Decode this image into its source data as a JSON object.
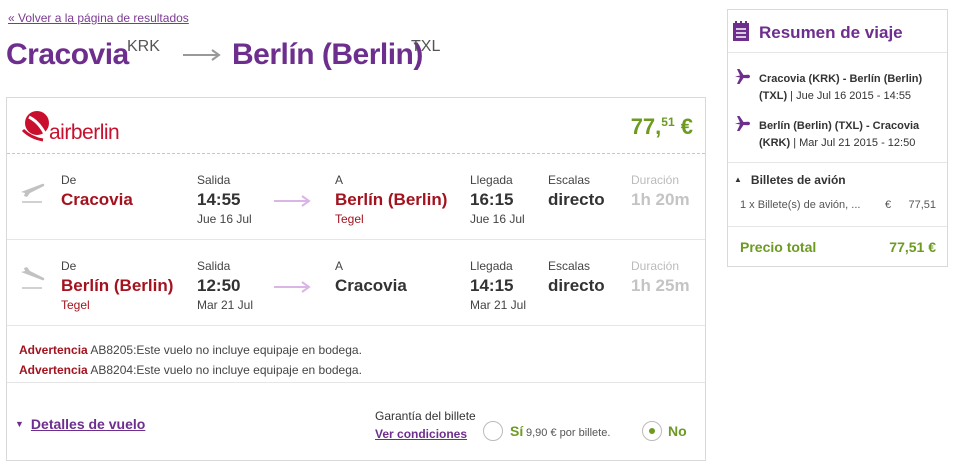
{
  "back_link": "« Volver a la página de resultados",
  "route": {
    "origin_city": "Cracovia",
    "origin_code": "KRK",
    "destination_city": "Berlín (Berlin)",
    "destination_code": "TXL"
  },
  "card": {
    "airline_logo_text": "airberlin",
    "price_int": "77,",
    "price_dec": "51",
    "price_currency": " €",
    "legs": [
      {
        "from_label": "De",
        "from_city": "Cracovia",
        "from_airport": "",
        "depart_label": "Salida",
        "depart_time": "14:55",
        "depart_date": "Jue 16 Jul",
        "to_label": "A",
        "to_city": "Berlín (Berlin)",
        "to_airport": "Tegel",
        "arrive_label": "Llegada",
        "arrive_time": "16:15",
        "arrive_date": "Jue 16 Jul",
        "stops_label": "Escalas",
        "stops_value": "directo",
        "duration_label": "Duración",
        "duration_value": "1h 20m"
      },
      {
        "from_label": "De",
        "from_city": "Berlín (Berlin)",
        "from_airport": "Tegel",
        "depart_label": "Salida",
        "depart_time": "12:50",
        "depart_date": "Mar 21 Jul",
        "to_label": "A",
        "to_city": "Cracovia",
        "to_airport": "",
        "arrive_label": "Llegada",
        "arrive_time": "14:15",
        "arrive_date": "Mar 21 Jul",
        "stops_label": "Escalas",
        "stops_value": "directo",
        "duration_label": "Duración",
        "duration_value": "1h 25m"
      }
    ],
    "warnings": [
      {
        "label": "Advertencia",
        "text": " AB8205:Este vuelo no incluye equipaje en bodega."
      },
      {
        "label": "Advertencia",
        "text": " AB8204:Este vuelo no incluye equipaje en bodega."
      }
    ],
    "details_link": "Detalles de vuelo",
    "guarantee_title": "Garantía del billete",
    "conditions_link": "Ver condiciones",
    "option_yes": "Sí",
    "option_yes_detail": "9,90 € por billete.",
    "option_no": "No",
    "selected_option": "No"
  },
  "summary": {
    "title": "Resumen de viaje",
    "legs": [
      {
        "route": "Cracovia (KRK) - Berlín (Berlin) (TXL)",
        "date": " | Jue Jul 16 2015 - 14:55"
      },
      {
        "route": "Berlín (Berlin) (TXL) - Cracovia (KRK)",
        "date": " | Mar Jul 21 2015 - 12:50"
      }
    ],
    "tickets_label": "Billetes de avión",
    "ticket_line": "1 x Billete(s) de avión, ...",
    "ticket_currency": "€",
    "ticket_amount": "77,51",
    "total_label": "Precio total",
    "total_amount": "77,51 €"
  },
  "colors": {
    "brand_purple": "#6e2e8e",
    "price_green": "#6d9a21",
    "city_red": "#a3131f",
    "airline_red": "#c8102e"
  }
}
